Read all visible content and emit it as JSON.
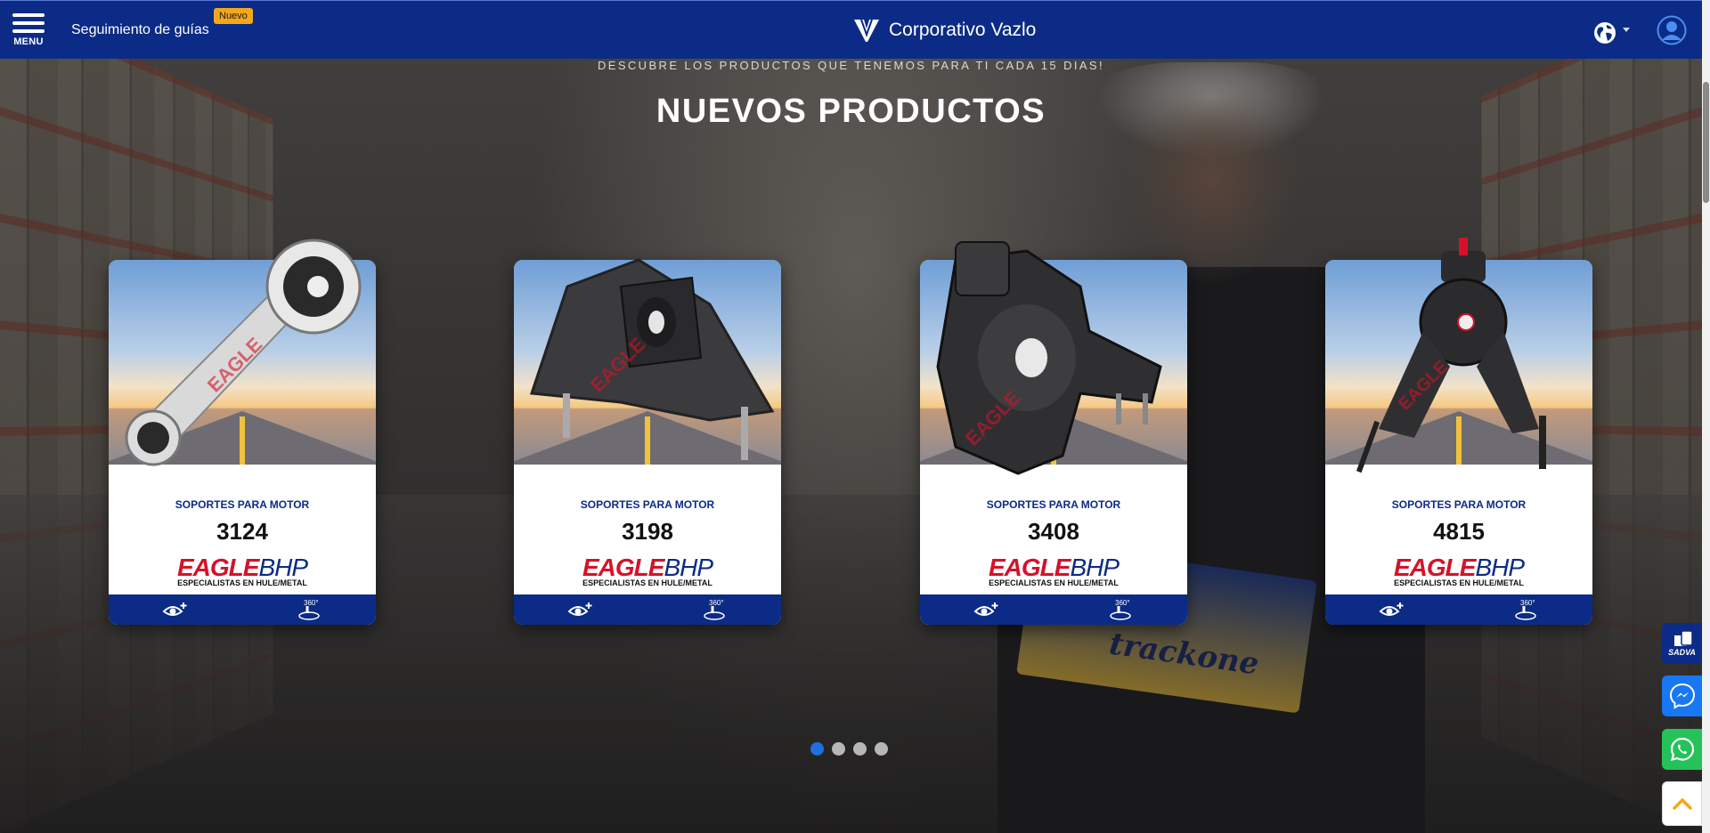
{
  "header": {
    "menu_label": "MENU",
    "tracking_link": "Seguimiento de guías",
    "new_badge": "Nuevo",
    "brand_name": "Corporativo Vazlo"
  },
  "section": {
    "subtitle": "DESCUBRE LOS PRODUCTOS QUE TENEMOS PARA TI CADA 15 DIAS!",
    "title": "NUEVOS PRODUCTOS"
  },
  "background": {
    "box_label": "trackone"
  },
  "products": [
    {
      "category": "SOPORTES PARA MOTOR",
      "code": "3124",
      "brand": "EAGLE",
      "brand_suffix": "BHP",
      "brand_tagline": "ESPECIALISTAS EN HULE/METAL",
      "view_icon": "eye-plus-icon",
      "rotate_icon": "360-icon"
    },
    {
      "category": "SOPORTES PARA MOTOR",
      "code": "3198",
      "brand": "EAGLE",
      "brand_suffix": "BHP",
      "brand_tagline": "ESPECIALISTAS EN HULE/METAL",
      "view_icon": "eye-plus-icon",
      "rotate_icon": "360-icon"
    },
    {
      "category": "SOPORTES PARA MOTOR",
      "code": "3408",
      "brand": "EAGLE",
      "brand_suffix": "BHP",
      "brand_tagline": "ESPECIALISTAS EN HULE/METAL",
      "view_icon": "eye-plus-icon",
      "rotate_icon": "360-icon"
    },
    {
      "category": "SOPORTES PARA MOTOR",
      "code": "4815",
      "brand": "EAGLE",
      "brand_suffix": "BHP",
      "brand_tagline": "ESPECIALISTAS EN HULE/METAL",
      "view_icon": "eye-plus-icon",
      "rotate_icon": "360-icon"
    }
  ],
  "carousel": {
    "pages": 4,
    "active": 1
  },
  "floating": {
    "sadva_label": "SADVA",
    "icons": [
      "sadva-icon",
      "messenger-icon",
      "whatsapp-icon",
      "chevron-up-icon"
    ]
  },
  "colors": {
    "header_bg": "#0b2b86",
    "brand_red": "#d5122a",
    "badge": "#f3a71a",
    "dot_active": "#1f6fe0",
    "whatsapp": "#25c25a",
    "messenger": "#1877f2"
  }
}
